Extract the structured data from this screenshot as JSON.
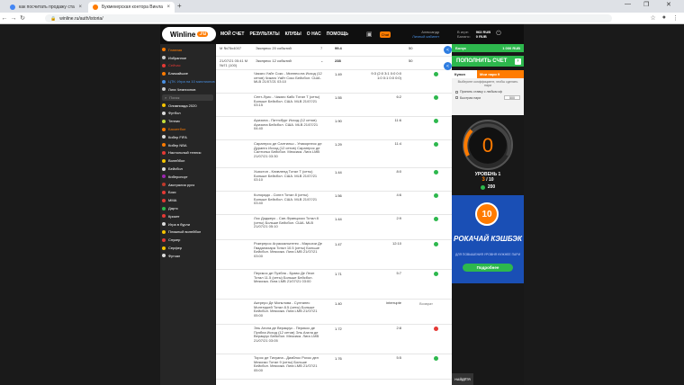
{
  "browser": {
    "tabs": [
      {
        "title": "как посчитать продажу ставок"
      },
      {
        "title": "Букмекерская контора Винлайн"
      }
    ],
    "url": "winline.ru/auth/istoria/"
  },
  "header": {
    "logo_text": "Winline",
    "logo_badge": ".ru",
    "menu": [
      "МОЙ СЧЕТ",
      "РЕЗУЛЬТАТЫ",
      "КЛУБЫ",
      "О НАС",
      "ПОМОЩЬ"
    ],
    "chat": "Chat",
    "user_name": "Александр",
    "user_link": "Личный кабинет",
    "balance_label": "В игре:",
    "balance_label2": "Баланс:",
    "balance_value": "963 RUB",
    "balance_value2": "0 RUB"
  },
  "sidebar": {
    "items": [
      {
        "label": "Главная",
        "color": "#ff7b00"
      },
      {
        "label": "Избранное",
        "color": "#ffffff"
      },
      {
        "label": "Сейчас",
        "color": "#e53935"
      },
      {
        "label": "Ближайшие",
        "color": "#ffffff"
      },
      {
        "label": "ЦТК: Игра на 10 миллионов",
        "color": "#4a90e2"
      },
      {
        "label": "Лига Чемпионов",
        "color": "#ffffff"
      },
      {
        "label": "Поиск",
        "color": "#999999"
      },
      {
        "label": "Олимпиада 2020",
        "color": "#ffffff"
      },
      {
        "label": "Футбол",
        "color": "#ffffff"
      },
      {
        "label": "Теннис",
        "color": "#ffffff"
      },
      {
        "label": "Баскетбол",
        "color": "#ff7b00"
      },
      {
        "label": "Кибер FIFA",
        "color": "#ffffff"
      },
      {
        "label": "Кибер NBA",
        "color": "#ffffff"
      },
      {
        "label": "Настольный теннис",
        "color": "#ffffff"
      },
      {
        "label": "Волейбол",
        "color": "#ffffff"
      },
      {
        "label": "Бейсбол",
        "color": "#ffffff"
      },
      {
        "label": "Киберспорт",
        "color": "#ffffff"
      },
      {
        "label": "Австралия рулз",
        "color": "#ffffff"
      },
      {
        "label": "Бокс",
        "color": "#ffffff"
      },
      {
        "label": "MMA",
        "color": "#ffffff"
      },
      {
        "label": "Дартс",
        "color": "#ffffff"
      },
      {
        "label": "Крикет",
        "color": "#ffffff"
      },
      {
        "label": "Игра в бурли",
        "color": "#ffffff"
      },
      {
        "label": "Пляжный волейбол",
        "color": "#ffffff"
      },
      {
        "label": "Снукер",
        "color": "#ffffff"
      },
      {
        "label": "Серфер",
        "color": "#ffffff"
      },
      {
        "label": "Футзал",
        "color": "#ffffff"
      }
    ]
  },
  "bets": {
    "row1": {
      "date": "М №75x4007",
      "event": "Экспресс 20 событий",
      "mid": "7",
      "amount": "99.4",
      "ret": "50"
    },
    "row2": {
      "date": "21/07/21 05:41 М №71 (100)",
      "event": "Экспресс 12 событий",
      "mid": "⌄",
      "amount": "238",
      "ret": "50"
    },
    "legs": [
      {
        "desc": "Чикаго Уайт Сокс - Миннесота Исход (12 сетов) Чикаго Уайт Сокс Бейсбол. США. MLB 21/07/21 03:10",
        "coef": "1.49",
        "score": "9:3 (2:0 3:1 0:0 0:0 1:0 0:1 0:0 0:0)",
        "status": "won"
      },
      {
        "desc": "Сент-Луис - Чикаго Кабс Тотал Т (сеты) Больше Бейсбол. США. MLB 21/07/21 03:15",
        "coef": "1.55",
        "score": "6:2",
        "status": "won"
      },
      {
        "desc": "Аризона - Питтсбург Исход (12 сетов) Аризона Бейсбол. США. MLB 21/07/21 04:40",
        "coef": "1.90",
        "score": "11:6",
        "status": "won"
      },
      {
        "desc": "Сарагерос де Салтильо - Уникорнеос де Дуранго Исход (12 сетов) Сарагерос де Салтильо Бейсбол. Мексика. Лига LMB 21/07/21 03:30",
        "coef": "1.29",
        "score": "11:4",
        "status": "won"
      },
      {
        "desc": "Хьюстон - Кливленд Тотал Т (сеты) Больше Бейсбол. США. MLB 21/07/21 03:10",
        "coef": "1.44",
        "score": "8:0",
        "status": "won"
      },
      {
        "desc": "Колорадо - Сиэтл Тотал 8 (сеты) Больше Бейсбол. США. MLB 21/07/21 03:40",
        "coef": "1.56",
        "score": "4:6",
        "status": "won"
      },
      {
        "desc": "Лос Доджерс - Сан-Франциско Тотал 8 (сеты) Больше Бейсбол. США. MLB 21/07/21 05:10",
        "coef": "1.44",
        "score": "2:9",
        "status": "won"
      },
      {
        "desc": "Рокерерос Агуаскальентес - Марьячи Де Гвадалахара Тотал 10.5 (сеты) Больше Бейсбол. Мексика. Лига LMB 21/07/21 03:00",
        "coef": "1.47",
        "score": "12:10",
        "status": "won"
      },
      {
        "desc": "Перикос де Пуэбла - Браво Де Леон Тотал 11.5 (сеты) Больше Бейсбол. Мексика. Лига LMB 21/07/21 03:00",
        "coef": "1.71",
        "score": "5:7",
        "status": "won"
      },
      {
        "desc": "Акереро Де Монклова - Султанес Монтеррей Тотал 8.5 (сеты) Больше Бейсбол. Мексика. Лига LMB 21/07/21 05:00",
        "coef": "1.40",
        "score": "interrupte",
        "status": "void",
        "status_text": "Возврат"
      },
      {
        "desc": "Эль Агила де Веракрус - Перикос де Пуэбла Исход (12 сетов) Эль Агила де Веракрус Бейсбол. Мексика. Лига LMB 21/07/21 03:05",
        "coef": "1.72",
        "score": "2:8",
        "status": "lost"
      },
      {
        "desc": "Торос де Тихуана - Диаблос Рохос дел Мексико Тотал 9 (сеты) Больше Бейсбол. Мексика. Лига LMB 21/07/21 05:00",
        "coef": "1.76",
        "score": "5:5",
        "status": "won"
      }
    ]
  },
  "right": {
    "bonus_label": "Бонус",
    "bonus_value": "1 000 RUB",
    "deposit_label": "ПОПОЛНИТЬ СЧЕТ",
    "coupon_tab": "Купон",
    "mybets_tab": "Мои пари 9",
    "coupon_hint": "Выберите коэффициент, чтобы сделать пари",
    "opt1": "Принять ставку с любым кф",
    "opt2": "Быстрая пари",
    "opt2_value": "500",
    "gauge_value": "0",
    "level_label": "УРОВЕНЬ 1",
    "level_cur": "3",
    "level_total": "/ 10",
    "points": "200",
    "promo_num": "10",
    "promo_title": "РОКАЧАЙ КЭШБЭК",
    "promo_sub": "ДЛЯ ПОВЫШЕНИЯ УРОВНЯ НУЖНЕЕ ПАРИ",
    "promo_btn": "Подробнее",
    "findme": "НАЙДЁТЯ"
  },
  "colors": {
    "accent": "#ff7b00",
    "green": "#2db84d",
    "blue": "#2e7de1"
  }
}
